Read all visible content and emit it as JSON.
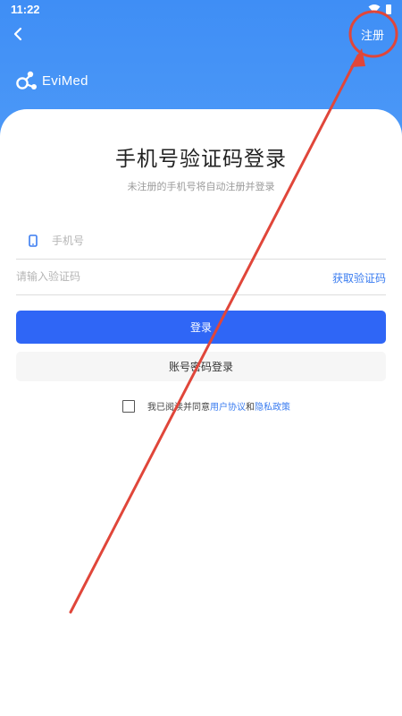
{
  "status_bar": {
    "time": "11:22"
  },
  "header": {
    "back_icon": "chevron-left-icon",
    "register_label": "注册",
    "logo_icon": "evimed-logo-icon",
    "logo_text": "EviMed"
  },
  "main": {
    "title": "手机号验证码登录",
    "subtitle": "未注册的手机号将自动注册并登录",
    "phone_icon": "mobile-phone-icon",
    "phone_placeholder": "手机号",
    "code_placeholder": "请输入验证码",
    "get_code_label": "获取验证码",
    "login_label": "登录",
    "password_login_label": "账号密码登录"
  },
  "agreement": {
    "prefix": "我已阅读并同意",
    "user_agreement": "用户协议",
    "conjunction": "和",
    "privacy_policy": "隐私政策"
  },
  "colors": {
    "header_blue": "#4f9bf8",
    "primary_button": "#2f66f6",
    "link": "#3a7cf0",
    "annotation_red": "#e0463a"
  },
  "annotation": {
    "type": "red arrow pointing to circled register link"
  }
}
